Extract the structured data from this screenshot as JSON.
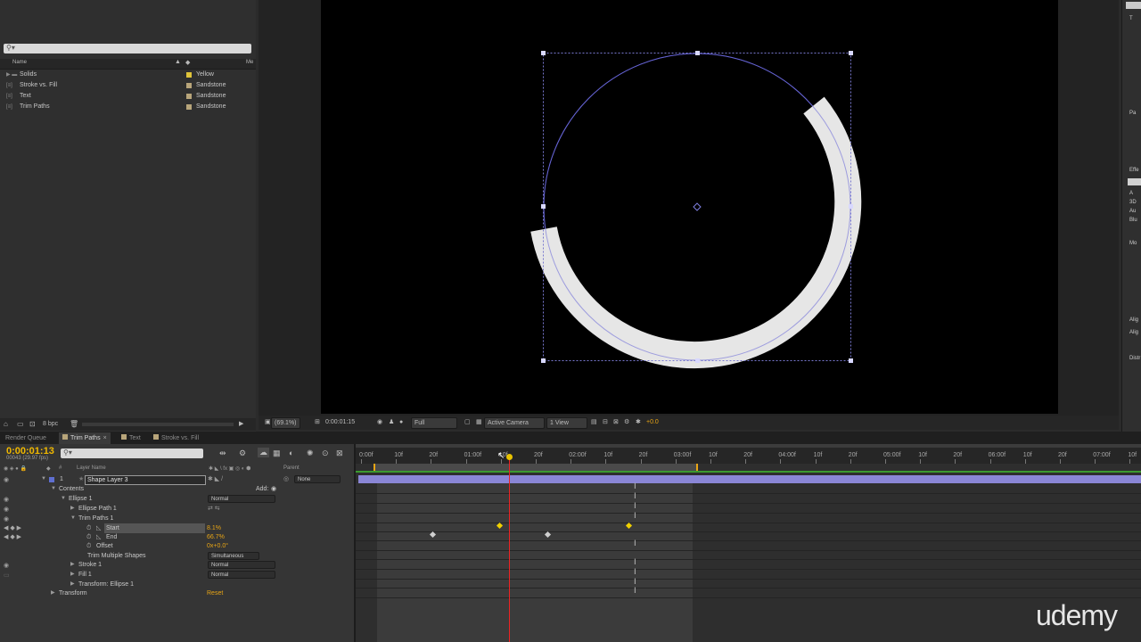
{
  "project": {
    "columns": {
      "name": "Name",
      "media": "Me"
    },
    "items": [
      {
        "name": "Solids",
        "type": "folder",
        "label": "Yellow",
        "label_color": "#e0c43a"
      },
      {
        "name": "Stroke vs. Fill",
        "type": "comp",
        "label": "Sandstone",
        "label_color": "#b8a57a"
      },
      {
        "name": "Text",
        "type": "comp",
        "label": "Sandstone",
        "label_color": "#b8a57a"
      },
      {
        "name": "Trim Paths",
        "type": "comp",
        "label": "Sandstone",
        "label_color": "#b8a57a"
      }
    ],
    "bpc": "8 bpc"
  },
  "viewer": {
    "zoom": "(69.1%)",
    "timecode": "0:00:01:15",
    "resolution": "Full",
    "camera": "Active Camera",
    "views": "1 View",
    "exposure": "+0.0"
  },
  "right_panel": {
    "labels": [
      "Pa",
      "Effe",
      "Mo",
      "Alig",
      "Alig",
      "Distr"
    ],
    "effect_items": [
      "A",
      "3D",
      "Au",
      "Blu"
    ]
  },
  "tabs": [
    {
      "label": "Render Queue",
      "active": false
    },
    {
      "label": "Trim Paths",
      "active": true
    },
    {
      "label": "Text",
      "active": false
    },
    {
      "label": "Stroke vs. Fill",
      "active": false
    }
  ],
  "timeline": {
    "current_time": "0:00:01:13",
    "frame_info": "00043 (29.97 fps)",
    "columns": {
      "layer_name": "Layer Name",
      "parent": "Parent"
    },
    "layer": {
      "index": "1",
      "name": "Shape Layer 3",
      "parent": "None"
    },
    "rows": {
      "contents": "Contents",
      "add": "Add:",
      "ellipse": "Ellipse 1",
      "ellipse_mode": "Normal",
      "ellipse_path": "Ellipse Path 1",
      "trim": "Trim Paths 1",
      "start": "Start",
      "start_value": "8.1%",
      "end": "End",
      "end_value": "66.7%",
      "offset": "Offset",
      "offset_value": "0x+0.0°",
      "trim_multiple": "Trim Multiple Shapes",
      "trim_multiple_value": "Simultaneous",
      "stroke": "Stroke 1",
      "stroke_mode": "Normal",
      "fill": "Fill 1",
      "fill_mode": "Normal",
      "transform_ellipse": "Transform: Ellipse 1",
      "transform": "Transform",
      "reset": "Reset"
    },
    "ruler_labels": [
      "0:00f",
      "10f",
      "20f",
      "01:00f",
      "10f",
      "20f",
      "02:00f",
      "10f",
      "20f",
      "03:00f",
      "10f",
      "20f",
      "04:00f",
      "10f",
      "20f",
      "05:00f",
      "10f",
      "20f",
      "06:00f",
      "10f",
      "20f",
      "07:00f",
      "10f"
    ]
  },
  "watermark": "udemy",
  "colors": {
    "accent": "#e8a515",
    "layer_bar": "#8a86d6",
    "cti": "#e22222",
    "path": "#6d6ad8"
  }
}
